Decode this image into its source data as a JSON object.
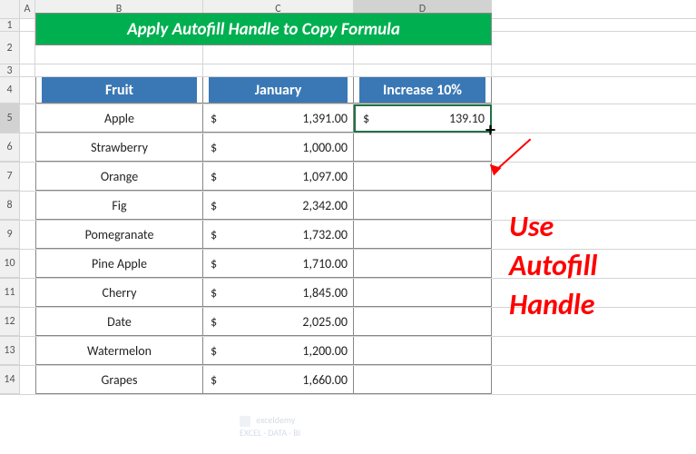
{
  "columns": {
    "A": "A",
    "B": "B",
    "C": "C",
    "D": "D"
  },
  "title": "Apply Autofill Handle to Copy Formula",
  "headers": {
    "fruit": "Fruit",
    "january": "January",
    "increase": "Increase 10%"
  },
  "currency": "$",
  "rows": [
    {
      "n": "5",
      "fruit": "Apple",
      "jan": "1,391.00",
      "inc": "139.10"
    },
    {
      "n": "6",
      "fruit": "Strawberry",
      "jan": "1,000.00",
      "inc": ""
    },
    {
      "n": "7",
      "fruit": "Orange",
      "jan": "1,097.00",
      "inc": ""
    },
    {
      "n": "8",
      "fruit": "Fig",
      "jan": "2,342.00",
      "inc": ""
    },
    {
      "n": "9",
      "fruit": "Pomegranate",
      "jan": "1,732.00",
      "inc": ""
    },
    {
      "n": "10",
      "fruit": "Pine Apple",
      "jan": "1,710.00",
      "inc": ""
    },
    {
      "n": "11",
      "fruit": "Cherry",
      "jan": "1,845.00",
      "inc": ""
    },
    {
      "n": "12",
      "fruit": "Date",
      "jan": "2,025.00",
      "inc": ""
    },
    {
      "n": "13",
      "fruit": "Watermelon",
      "jan": "1,200.00",
      "inc": ""
    },
    {
      "n": "14",
      "fruit": "Grapes",
      "jan": "1,660.00",
      "inc": ""
    }
  ],
  "annotation": {
    "l1": "Use",
    "l2": "Autofill",
    "l3": "Handle"
  },
  "watermark": {
    "brand": "exceldemy",
    "tag": "EXCEL · DATA · BI"
  }
}
